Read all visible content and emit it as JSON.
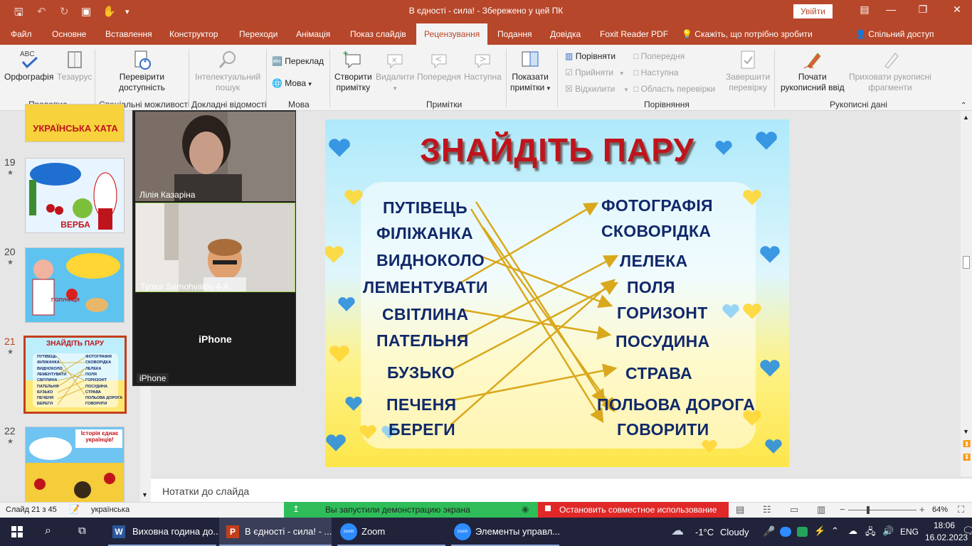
{
  "title_bar": {
    "doc_title": "В єдності - сила! - Збережено у цей ПК",
    "sign_in": "Увійти"
  },
  "tabs": [
    "Файл",
    "Основне",
    "Вставлення",
    "Конструктор",
    "Переходи",
    "Анімація",
    "Показ слайдів",
    "Рецензування",
    "Подання",
    "Довідка",
    "Foxit Reader PDF"
  ],
  "tell_me": "Скажіть, що потрібно зробити",
  "share": "Спільний доступ",
  "ribbon": {
    "spelling": "Орфографія",
    "thesaurus": "Тезаурус",
    "grp_proofing": "Правопис",
    "check_access_1": "Перевірити",
    "check_access_2": "доступність",
    "grp_access": "Спеціальні можливості",
    "smart_1": "Інтелектуальний",
    "smart_2": "пошук",
    "grp_insights": "Докладні відомості",
    "translate": "Переклад",
    "language": "Мова",
    "grp_language": "Мова",
    "new_comment_1": "Створити",
    "new_comment_2": "примітку",
    "delete": "Видалити",
    "previous": "Попередня",
    "next": "Наступна",
    "show_comments_1": "Показати",
    "show_comments_2": "примітки",
    "grp_comments": "Примітки",
    "compare": "Порівняти",
    "accept": "Прийняти",
    "reject": "Відхилити",
    "cmp_prev": "Попередня",
    "cmp_next": "Наступна",
    "review_pane": "Область перевірки",
    "end_review_1": "Завершити",
    "end_review_2": "перевірку",
    "grp_compare": "Порівняння",
    "start_ink_1": "Почати",
    "start_ink_2": "рукописний ввід",
    "hide_ink_1": "Приховати рукописні",
    "hide_ink_2": "фрагменти",
    "grp_ink": "Рукописні дані"
  },
  "thumbnails": [
    {
      "num": "19",
      "caption": "ВЕРБА"
    },
    {
      "num": "20",
      "caption": "ПОЛУНИЦЯ"
    },
    {
      "num": "21",
      "caption": "ЗНАЙДІТЬ ПАРУ"
    },
    {
      "num": "22",
      "caption": "Історія єднає українців!"
    }
  ],
  "top_thumb_caption": "УКРАЇНСЬКА ХАТА",
  "zoom": {
    "p1": "Лілія Казаріна",
    "p2": "Tymur Samohvalov 4-А",
    "p3_center": "iPhone",
    "p3": "iPhone"
  },
  "slide": {
    "title": "ЗНАЙДІТЬ ПАРУ",
    "left": [
      "ПУТІВЕЦЬ",
      "ФІЛІЖАНКА",
      "ВИДНОКОЛО",
      "ЛЕМЕНТУВАТИ",
      "СВІТЛИНА",
      "ПАТЕЛЬНЯ",
      "БУЗЬКО",
      "ПЕЧЕНЯ",
      "БЕРЕГИ"
    ],
    "right": [
      "ФОТОГРАФІЯ",
      "СКОВОРІДКА",
      "ЛЕЛЕКА",
      "ПОЛЯ",
      "ГОРИЗОНТ",
      "ПОСУДИНА",
      "СТРАВА",
      "ПОЛЬОВА ДОРОГА",
      "ГОВОРИТИ"
    ]
  },
  "mini_slide": {
    "left": [
      "ПУТІВЕЦЬ",
      "ФІЛІЖАНКА",
      "ВИДНОКОЛО",
      "ЛЕМЕНТУВАТИ",
      "СВІТЛИНА",
      "ПАТЕЛЬНЯ",
      "БУЗЬКО",
      "ПЕЧЕНЯ",
      "БЕРЕГИ"
    ],
    "right": [
      "ФОТОГРАФІЯ",
      "СКОВОРІДКА",
      "ЛЕЛЕКА",
      "ПОЛЯ",
      "ГОРИЗОНТ",
      "ПОСУДИНА",
      "СТРАВА",
      "ПОЛЬОВА ДОРОГА",
      "ГОВОРИТИ"
    ]
  },
  "notes_placeholder": "Нотатки до слайда",
  "status": {
    "slide": "Слайд 21 з 45",
    "language": "українська",
    "share_msg": "Вы запустили демонстрацию экрана",
    "stop_share": "Остановить совместное использование",
    "zoom_pct": "64%"
  },
  "taskbar": {
    "word": "Виховна година до...",
    "ppt": "В єдності - сила! - ...",
    "zoom": "Zoom",
    "zoom_ctrl": "Элементы управл...",
    "weather_temp": "-1°C",
    "weather_desc": "Cloudy",
    "lang": "ENG",
    "time": "18:06",
    "date": "16.02.2023"
  },
  "colors": {
    "accent": "#b7472a",
    "slide_title": "#c0141c",
    "word_text": "#11296a",
    "arrow": "#d9a81c",
    "zoom_green": "#2ebd59",
    "zoom_red": "#e02828"
  }
}
